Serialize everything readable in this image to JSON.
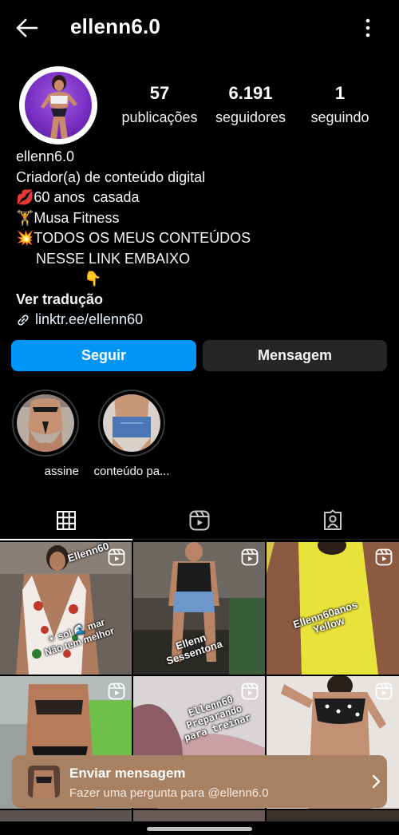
{
  "header": {
    "title": "ellenn6.0",
    "back_icon": "arrow-left-icon",
    "more_icon": "more-vertical-icon"
  },
  "stats": [
    {
      "value": "57",
      "label": "publicações"
    },
    {
      "value": "6.191",
      "label": "seguidores"
    },
    {
      "value": "1",
      "label": "seguindo"
    }
  ],
  "bio": {
    "name": "ellenn6.0",
    "category": "Criador(a) de conteúdo digital",
    "lines": [
      "💋60 anos  casada",
      "🏋Musa Fitness",
      "💥TODOS OS MEUS CONTEÚDOS",
      "     NESSE LINK EMBAIXO",
      "                 👇"
    ],
    "translate": "Ver tradução",
    "link": "linktr.ee/ellenn60"
  },
  "actions": {
    "follow": "Seguir",
    "message": "Mensagem"
  },
  "highlights": [
    {
      "label": "assine"
    },
    {
      "label": "conteúdo pa..."
    }
  ],
  "tabs": [
    {
      "name": "grid",
      "icon": "grid-icon",
      "active": true
    },
    {
      "name": "reels",
      "icon": "reels-icon",
      "active": false
    },
    {
      "name": "tagged",
      "icon": "tagged-user-icon",
      "active": false
    }
  ],
  "posts": [
    {
      "caption": "Ellenn60",
      "caption2": "☀ sol 🌊 mar\nNão tem melhor"
    },
    {
      "caption": "Ellenn\nSessentona"
    },
    {
      "caption": "Ellenn60anos\nYellow"
    },
    {
      "caption": ""
    },
    {
      "caption": "Ellenn60\nPreparando\npara treinar"
    },
    {
      "caption": ""
    }
  ],
  "toast": {
    "title": "Enviar mensagem",
    "subtitle": "Fazer uma pergunta para @ellenn6.0"
  },
  "colors": {
    "follow": "#0095f6",
    "toast": "#a88062",
    "background": "#000000"
  }
}
